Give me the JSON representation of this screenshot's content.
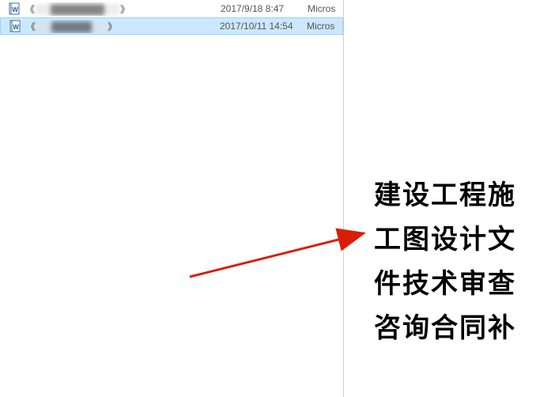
{
  "files": [
    {
      "name_prefix": "《",
      "name_blurred": "████████",
      "name_suffix": "》",
      "date": "2017/9/18 8:47",
      "type": "Micros",
      "selected": false
    },
    {
      "name_prefix": "《",
      "name_blurred": "██████",
      "name_suffix": "》",
      "date": "2017/10/11 14:54",
      "type": "Micros",
      "selected": true
    }
  ],
  "preview_text": "建设工程施工图设计文件技术审查咨询合同补",
  "arrow_color": "#d81e06"
}
